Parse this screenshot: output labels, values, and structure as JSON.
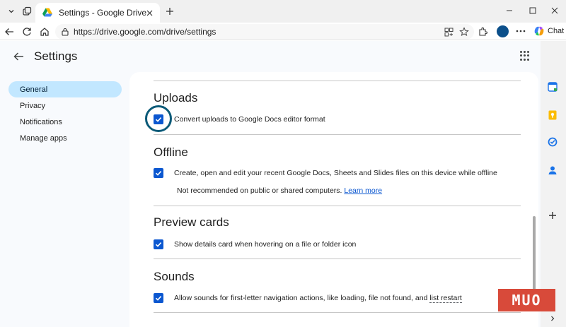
{
  "browser": {
    "tab_title": "Settings - Google Drive",
    "url": "https://drive.google.com/drive/settings",
    "chat_label": "Chat"
  },
  "header": {
    "title": "Settings"
  },
  "sidebar": {
    "items": [
      {
        "label": "General",
        "active": true
      },
      {
        "label": "Privacy",
        "active": false
      },
      {
        "label": "Notifications",
        "active": false
      },
      {
        "label": "Manage apps",
        "active": false
      }
    ]
  },
  "sections": {
    "uploads": {
      "title": "Uploads",
      "option": "Convert uploads to Google Docs editor format",
      "checked": true
    },
    "offline": {
      "title": "Offline",
      "option": "Create, open and edit your recent Google Docs, Sheets and Slides files on this device while offline",
      "note": "Not recommended on public or shared computers.",
      "link": "Learn more",
      "checked": true
    },
    "preview": {
      "title": "Preview cards",
      "option": "Show details card when hovering on a file or folder icon",
      "checked": true
    },
    "sounds": {
      "title": "Sounds",
      "option_prefix": "Allow sounds for first-letter navigation actions, like loading, file not found, and",
      "option_link": "list restart",
      "checked": true
    }
  },
  "watermark": "MUO",
  "colors": {
    "accent": "#0b57d0",
    "nav_active_bg": "#c2e7ff",
    "page_bg": "#f8fafd",
    "highlight_ring": "#0b5a78",
    "watermark_bg": "#d84a3a"
  }
}
